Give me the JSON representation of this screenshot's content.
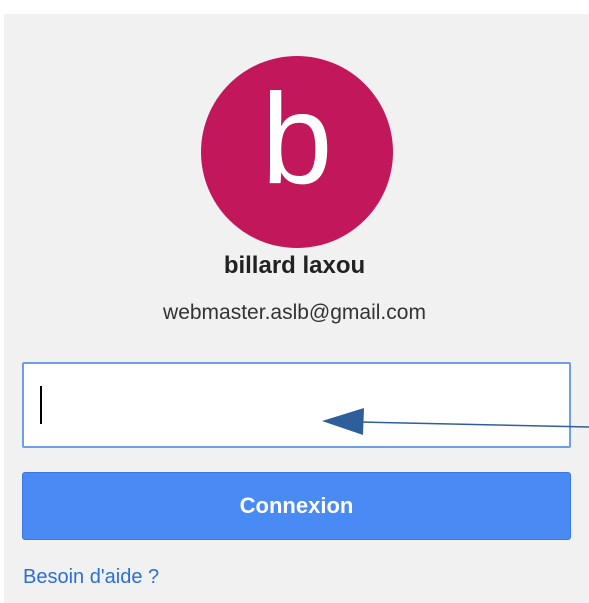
{
  "profile": {
    "avatar_letter": "b",
    "avatar_color": "#c2185b",
    "name": "billard laxou",
    "email": "webmaster.aslb@gmail.com"
  },
  "password_field": {
    "value": "",
    "placeholder": ""
  },
  "login_button": {
    "label": "Connexion",
    "color": "#4a8af4"
  },
  "help_link": {
    "label": "Besoin d'aide ?"
  },
  "annotation": {
    "arrow_color": "#2f5f9a",
    "arrow_icon": "arrow-left-icon"
  }
}
